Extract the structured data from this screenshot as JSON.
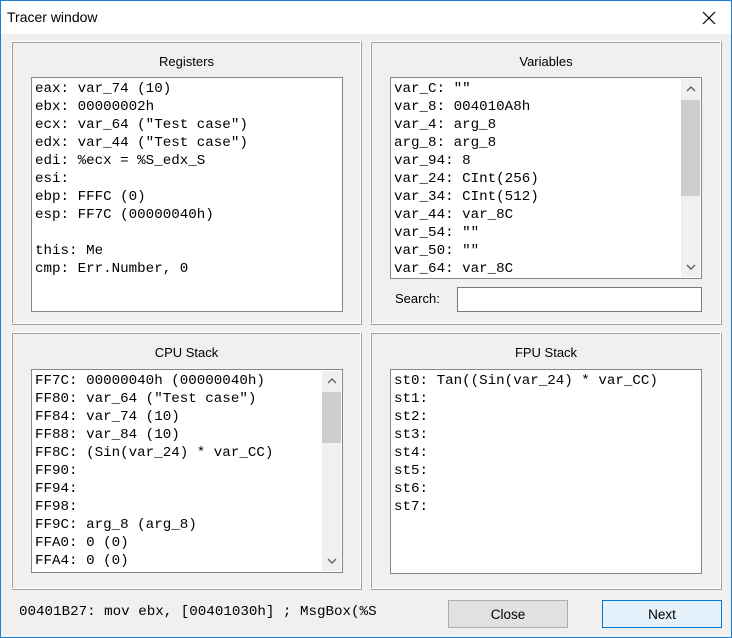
{
  "window": {
    "title": "Tracer window",
    "close_icon": "close-x-icon"
  },
  "registers": {
    "title": "Registers",
    "lines": [
      "eax: var_74 (10)",
      "ebx: 00000002h",
      "ecx: var_64 (\"Test case\")",
      "edx: var_44 (\"Test case\")",
      "edi: %ecx = %S_edx_S",
      "esi:",
      "ebp: FFFC (0)",
      "esp: FF7C (00000040h)",
      "",
      "this: Me",
      "cmp: Err.Number, 0"
    ]
  },
  "variables": {
    "title": "Variables",
    "lines": [
      "var_C: \"\"",
      "var_8: 004010A8h",
      "var_4: arg_8",
      "arg_8: arg_8",
      "var_94: 8",
      "var_24: CInt(256)",
      "var_34: CInt(512)",
      "var_44: var_8C",
      "var_54: \"\"",
      "var_50: \"\"",
      "var_64: var_8C"
    ],
    "search_label": "Search:",
    "search_value": "",
    "scroll_up_icon": "chevron-up-icon",
    "scroll_down_icon": "chevron-down-icon"
  },
  "cpu_stack": {
    "title": "CPU Stack",
    "lines": [
      "FF7C: 00000040h (00000040h)",
      "FF80: var_64 (\"Test case\")",
      "FF84: var_74 (10)",
      "FF88: var_84 (10)",
      "FF8C: (Sin(var_24) * var_CC)",
      "FF90:",
      "FF94:",
      "FF98:",
      "FF9C: arg_8 (arg_8)",
      "FFA0: 0 (0)",
      "FFA4: 0 (0)"
    ]
  },
  "fpu_stack": {
    "title": "FPU Stack",
    "lines": [
      "st0: Tan((Sin(var_24) * var_CC)",
      "st1:",
      "st2:",
      "st3:",
      "st4:",
      "st5:",
      "st6:",
      "st7:"
    ]
  },
  "status": {
    "instruction": "00401B27: mov ebx, [00401030h] ; MsgBox(%S"
  },
  "buttons": {
    "close_label": "Close",
    "next_label": "Next"
  },
  "colors": {
    "window_border": "#1a7fd4",
    "focus_button_border": "#0078d7",
    "focus_button_bg": "#e5f1fb",
    "scroll_thumb": "#cdcdcd"
  }
}
